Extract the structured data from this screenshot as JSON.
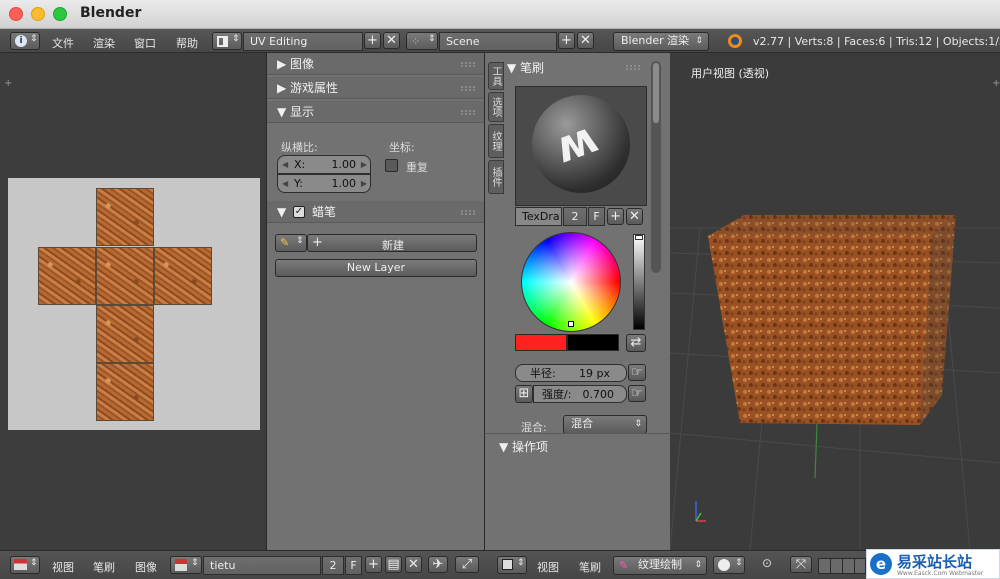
{
  "window": {
    "title": "Blender"
  },
  "info_header": {
    "menus": [
      "文件",
      "渲染",
      "窗口",
      "帮助"
    ],
    "layout": "UV Editing",
    "scene": "Scene",
    "engine": "Blender 渲染",
    "stats": "v2.77 | Verts:8 | Faces:6 | Tris:12 | Objects:1/3 | L"
  },
  "properties": {
    "image_panel": "图像",
    "game_props_panel": "游戏属性",
    "display_panel": "显示",
    "aspect_label": "纵横比:",
    "x_label": "X:",
    "x_value": "1.00",
    "y_label": "Y:",
    "y_value": "1.00",
    "coords_label": "坐标:",
    "repeat_label": "重复",
    "grease_panel": "蜡笔",
    "new_label": "新建",
    "new_layer_label": "New Layer"
  },
  "tool_shelf": {
    "tabs": [
      "工具",
      "选项",
      "纹理",
      "插件"
    ],
    "brush_panel": "笔刷",
    "texture_name": "TexDra",
    "user_count": "2",
    "fake_user": "F",
    "radius_label": "半径:",
    "radius_value": "19 px",
    "strength_label": "强度/:",
    "strength_value": "0.700",
    "blend_label": "混合:",
    "blend_value": "混合",
    "operator_panel": "操作项",
    "primary_color": "#ff2020",
    "secondary_color": "#000000"
  },
  "viewport": {
    "label": "用户视图 (透视)"
  },
  "uv_footer": {
    "menus": [
      "视图",
      "笔刷",
      "图像"
    ],
    "image_name": "tietu",
    "user_count": "2",
    "fake_user": "F"
  },
  "view3d_footer": {
    "menus": [
      "视图",
      "笔刷"
    ],
    "mode": "纹理绘制"
  },
  "watermark": {
    "text": "易采站长站",
    "subtext": "Www.Easck.Com Webmaster"
  }
}
